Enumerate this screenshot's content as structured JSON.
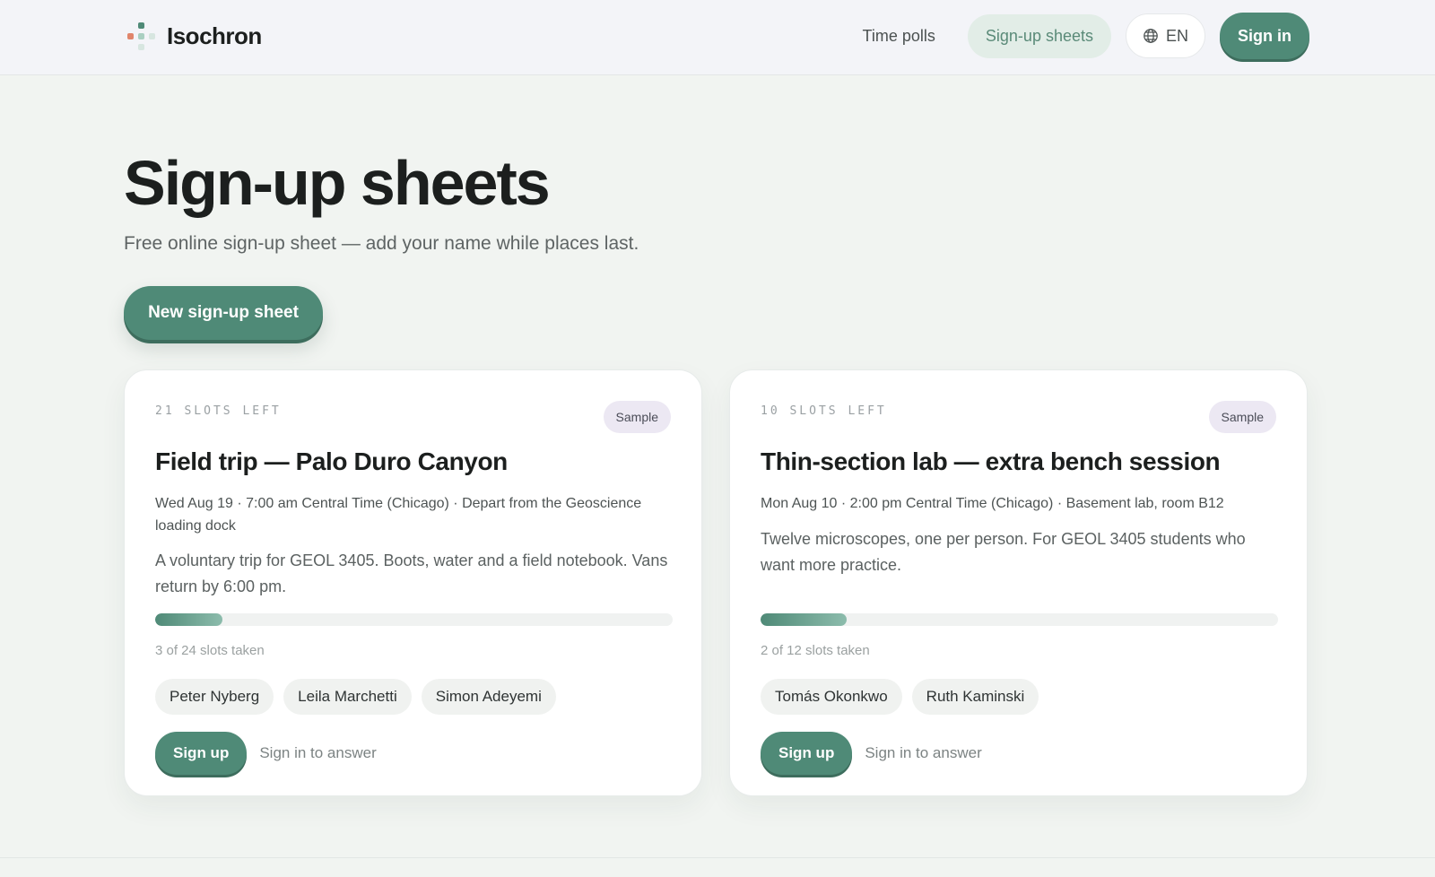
{
  "header": {
    "brand": "Isochron",
    "nav": [
      {
        "label": "Time polls",
        "active": false
      },
      {
        "label": "Sign-up sheets",
        "active": true
      }
    ],
    "language": "EN",
    "signin_label": "Sign in",
    "logo_colors": [
      "#e0856b",
      "#4f8a77",
      "#a9cfc1",
      "#d7e6e0"
    ]
  },
  "hero": {
    "title": "Sign-up sheets",
    "subtitle": "Free online sign-up sheet — add your name while places last.",
    "new_button": "New sign-up sheet"
  },
  "cards": [
    {
      "slots_left": "21 slots left",
      "badge": "Sample",
      "title": "Field trip — Palo Duro Canyon",
      "meta": "Wed Aug 19 · 7:00 am Central Time (Chicago) · Depart from the Geoscience loading dock",
      "description": "A voluntary trip for GEOL 3405. Boots, water and a field notebook. Vans return by 6:00 pm.",
      "taken": 3,
      "total": 24,
      "progress_text": "3 of 24 slots taken",
      "attendees": [
        "Peter Nyberg",
        "Leila Marchetti",
        "Simon Adeyemi"
      ],
      "signup_label": "Sign up",
      "signin_label": "Sign in to answer"
    },
    {
      "slots_left": "10 slots left",
      "badge": "Sample",
      "title": "Thin-section lab — extra bench session",
      "meta": "Mon Aug 10 · 2:00 pm Central Time (Chicago) · Basement lab, room B12",
      "description": "Twelve microscopes, one per person. For GEOL 3405 students who want more practice.",
      "taken": 2,
      "total": 12,
      "progress_text": "2 of 12 slots taken",
      "attendees": [
        "Tomás Okonkwo",
        "Ruth Kaminski"
      ],
      "signup_label": "Sign up",
      "signin_label": "Sign in to answer"
    }
  ],
  "colors": {
    "accent": "#4f8a77",
    "background": "#f1f4f1",
    "badge_bg": "#ece8f3"
  },
  "icons": {
    "language": "globe-icon",
    "logo": "dots-logo-icon"
  }
}
